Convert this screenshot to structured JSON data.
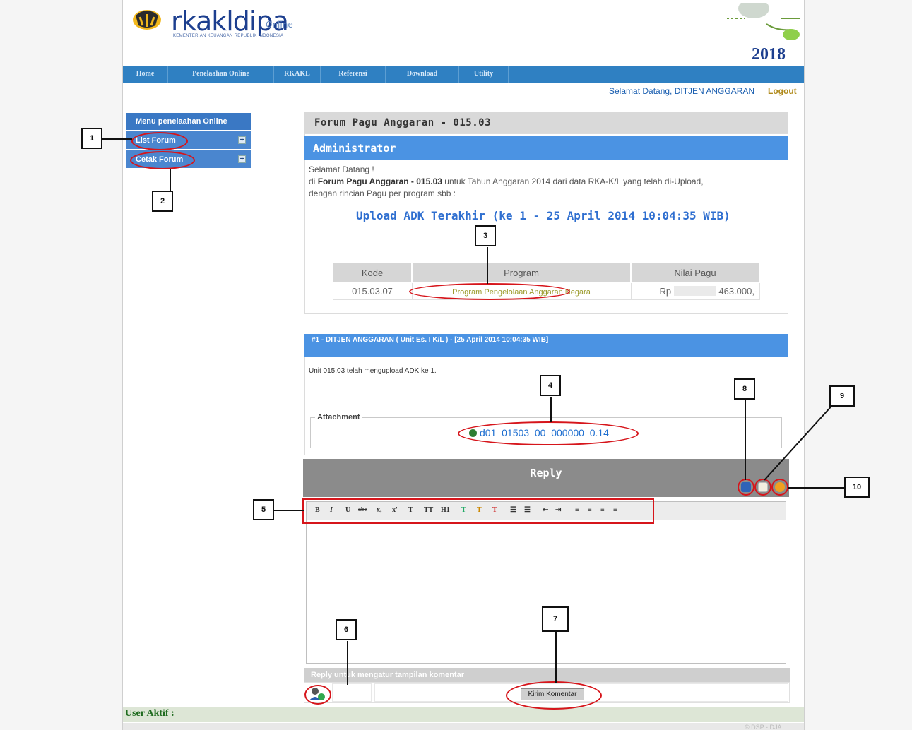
{
  "header": {
    "logo_text": "rkakldipa",
    "logo_online": "Online",
    "logo_sub": "KEMENTERIAN KEUANGAN REPUBLIK INDONESIA",
    "year": "2018"
  },
  "nav": {
    "items": [
      "Home",
      "Penelaahan Online",
      "RKAKL",
      "Referensi",
      "Download",
      "Utility"
    ]
  },
  "user": {
    "welcome": "Selamat Datang, DITJEN ANGGARAN",
    "logout": "Logout"
  },
  "menu": {
    "title": "Menu penelaahan Online",
    "items": [
      "List Forum",
      "Cetak Forum"
    ]
  },
  "forum": {
    "title": "Forum Pagu Anggaran - 015.03",
    "admin": "Administrator",
    "intro_greeting": "Selamat Datang !",
    "intro_prefix": "di",
    "intro_bold": "Forum Pagu Anggaran - 015.03",
    "intro_rest": "untuk Tahun Anggaran 2014 dari data RKA-K/L yang telah di-Upload,",
    "intro_line3": "dengan rincian Pagu per program sbb :",
    "upload_title": "Upload ADK Terakhir (ke 1 - 25 April 2014 10:04:35 WIB)",
    "table": {
      "headers": [
        "Kode",
        "Program",
        "Nilai Pagu"
      ],
      "rows": [
        {
          "kode": "015.03.07",
          "program": "Program Pengelolaan Anggaran Negara",
          "nilai_prefix": "Rp",
          "nilai": "463.000,-"
        }
      ]
    }
  },
  "post": {
    "header": "#1  -  DITJEN ANGGARAN ( Unit Es. I K/L )  -  [25 April 2014 10:04:35 WIB]",
    "body": "Unit 015.03 telah mengupload ADK ke 1.",
    "attachment_legend": "Attachment",
    "attachment_file": "d01_01503_00_000000_0.14"
  },
  "reply": {
    "title": "Reply",
    "toolbar": [
      "B",
      "I",
      "U",
      "abc",
      "x,",
      "x'",
      "T-",
      "TT-",
      "H1-",
      "T",
      "T",
      "T",
      "☰",
      "☰",
      "⇤",
      "⇥",
      "≡",
      "≡",
      "≡",
      "≡"
    ],
    "hint": "Reply untuk mengatur tampilan komentar",
    "submit": "Kirim Komentar"
  },
  "footer": {
    "user_aktif": "User Aktif :",
    "copy": "© DSP - DJA"
  },
  "annotations": [
    "1",
    "2",
    "3",
    "4",
    "5",
    "6",
    "7",
    "8",
    "9",
    "10"
  ],
  "colors": {
    "nav": "#2f80c2",
    "bar_blue": "#4b93e3",
    "annotation_red": "#d6151b"
  }
}
